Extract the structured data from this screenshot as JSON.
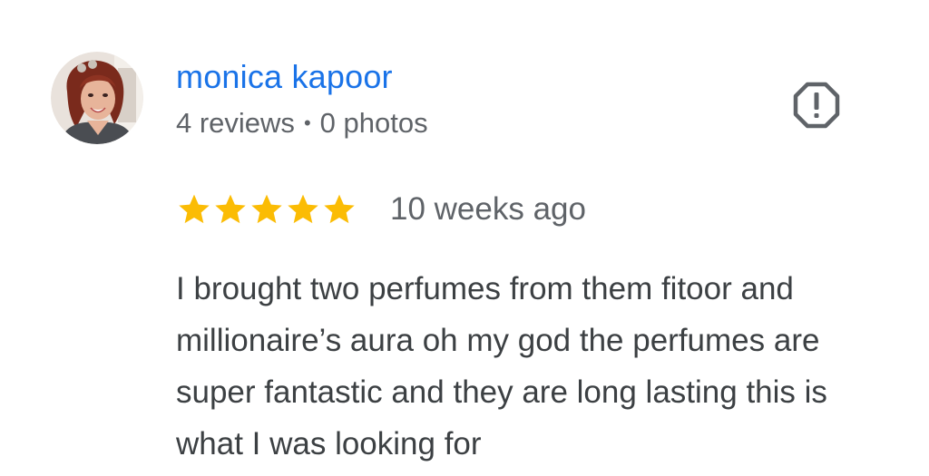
{
  "reviewer": {
    "name": "monica kapoor",
    "reviews_count": "4 reviews",
    "separator": "•",
    "photos_count": "0 photos"
  },
  "rating": {
    "stars": 5,
    "max_stars": 5,
    "star_color": "#fbbc04",
    "time_ago": "10 weeks ago"
  },
  "review": {
    "text": "I brought two perfumes from them fitoor and millionaire’s aura oh my god the perfumes are super fantastic and they are long lasting this is what I was looking for"
  },
  "icons": {
    "report": "report-flag-icon",
    "avatar": "reviewer-avatar",
    "star": "star-icon"
  },
  "colors": {
    "name_link": "#1a73e8",
    "meta_text": "#5f6368",
    "body_text": "#3c4043"
  }
}
